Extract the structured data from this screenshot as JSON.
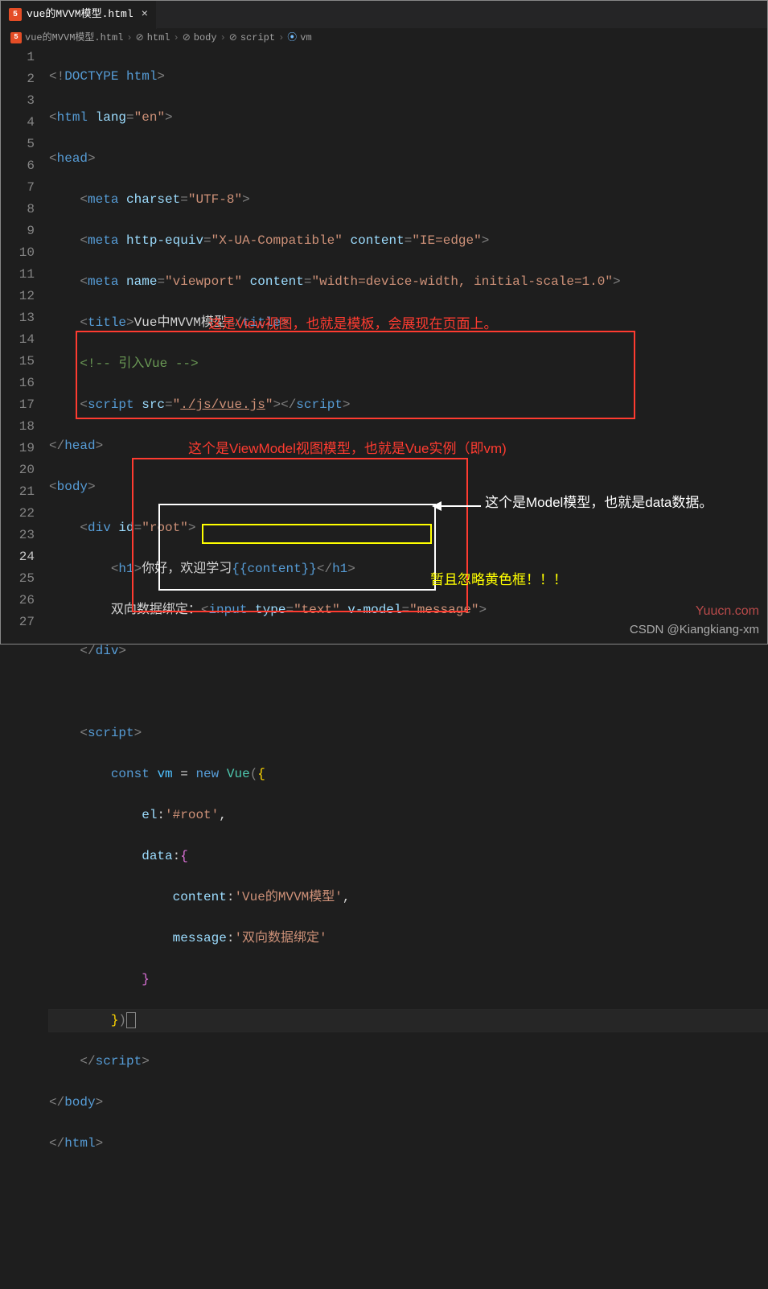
{
  "tab": {
    "label": "vue的MVVM模型.html",
    "close": "×"
  },
  "breadcrumb": {
    "file": "vue的MVVM模型.html",
    "items": [
      "html",
      "body",
      "script",
      "vm"
    ]
  },
  "gutter": {
    "start": 1,
    "end": 27,
    "active": 24
  },
  "code": {
    "l1": {
      "a": "<!",
      "b": "DOCTYPE ",
      "c": "html",
      "d": ">"
    },
    "l2": {
      "a": "<",
      "b": "html",
      "c": " lang",
      "d": "=",
      "e": "\"en\"",
      "f": ">"
    },
    "l3": {
      "a": "<",
      "b": "head",
      "c": ">"
    },
    "l4": {
      "a": "<",
      "b": "meta",
      "c": " charset",
      "d": "=",
      "e": "\"UTF-8\"",
      "f": ">"
    },
    "l5": {
      "a": "<",
      "b": "meta",
      "c": " http-equiv",
      "d": "=",
      "e": "\"X-UA-Compatible\"",
      "f": " content",
      "g": "=",
      "h": "\"IE=edge\"",
      "i": ">"
    },
    "l6": {
      "a": "<",
      "b": "meta",
      "c": " name",
      "d": "=",
      "e": "\"viewport\"",
      "f": " content",
      "g": "=",
      "h": "\"width=device-width, initial-scale=1.0\"",
      "i": ">"
    },
    "l7": {
      "a": "<",
      "b": "title",
      "c": ">",
      "d": "Vue中MVVM模型",
      "e": "</",
      "f": "title",
      "g": ">"
    },
    "l8": {
      "a": "<!-- 引入Vue -->"
    },
    "l9": {
      "a": "<",
      "b": "script",
      "c": " src",
      "d": "=",
      "e": "\"",
      "f": "./js/vue.js",
      "g": "\"",
      "h": ">",
      "i": "</",
      "j": "script",
      "k": ">"
    },
    "l10": {
      "a": "</",
      "b": "head",
      "c": ">"
    },
    "l11": {
      "a": "<",
      "b": "body",
      "c": ">"
    },
    "l12": {
      "a": "<",
      "b": "div",
      "c": " id",
      "d": "=",
      "e": "\"root\"",
      "f": ">"
    },
    "l13": {
      "a": "<",
      "b": "h1",
      "c": ">",
      "d": "你好，欢迎学习",
      "e": "{{content}}",
      "f": "</",
      "g": "h1",
      "h": ">"
    },
    "l14": {
      "a": "双向数据绑定：",
      "b": "<",
      "c": "input",
      "d": " type",
      "e": "=",
      "f": "\"text\"",
      "g": " v-model",
      "h": "=",
      "i": "\"message\"",
      "j": ">"
    },
    "l15": {
      "a": "</",
      "b": "div",
      "c": ">"
    },
    "l17": {
      "a": "<",
      "b": "script",
      "c": ">"
    },
    "l18": {
      "a": "const",
      "b": " ",
      "c": "vm",
      "d": " = ",
      "e": "new",
      "f": " ",
      "g": "Vue",
      "h": "(",
      "i": "{"
    },
    "l19": {
      "a": "el",
      "b": ":",
      "c": "'#root'",
      "d": ","
    },
    "l20": {
      "a": "data",
      "b": ":",
      "c": "{"
    },
    "l21": {
      "a": "content",
      "b": ":",
      "c": "'Vue的MVVM模型'",
      "d": ","
    },
    "l22": {
      "a": "message",
      "b": ":",
      "c": "'双向数据绑定'"
    },
    "l23": {
      "a": "}"
    },
    "l24": {
      "a": "}",
      "b": ")"
    },
    "l25": {
      "a": "</",
      "b": "script",
      "c": ">"
    },
    "l26": {
      "a": "</",
      "b": "body",
      "c": ">"
    },
    "l27": {
      "a": "</",
      "b": "html",
      "c": ">"
    }
  },
  "annotations": {
    "view": "这是View视图，也就是模板，会展现在页面上。",
    "vm": "这个是ViewModel视图模型，也就是Vue实例（即vm)",
    "model": "这个是Model模型，也就是data数据。",
    "ignore": "暂且忽略黄色框！！！"
  },
  "watermark": {
    "top": "Yuucn.com",
    "bottom": "CSDN @Kiangkiang-xm"
  }
}
